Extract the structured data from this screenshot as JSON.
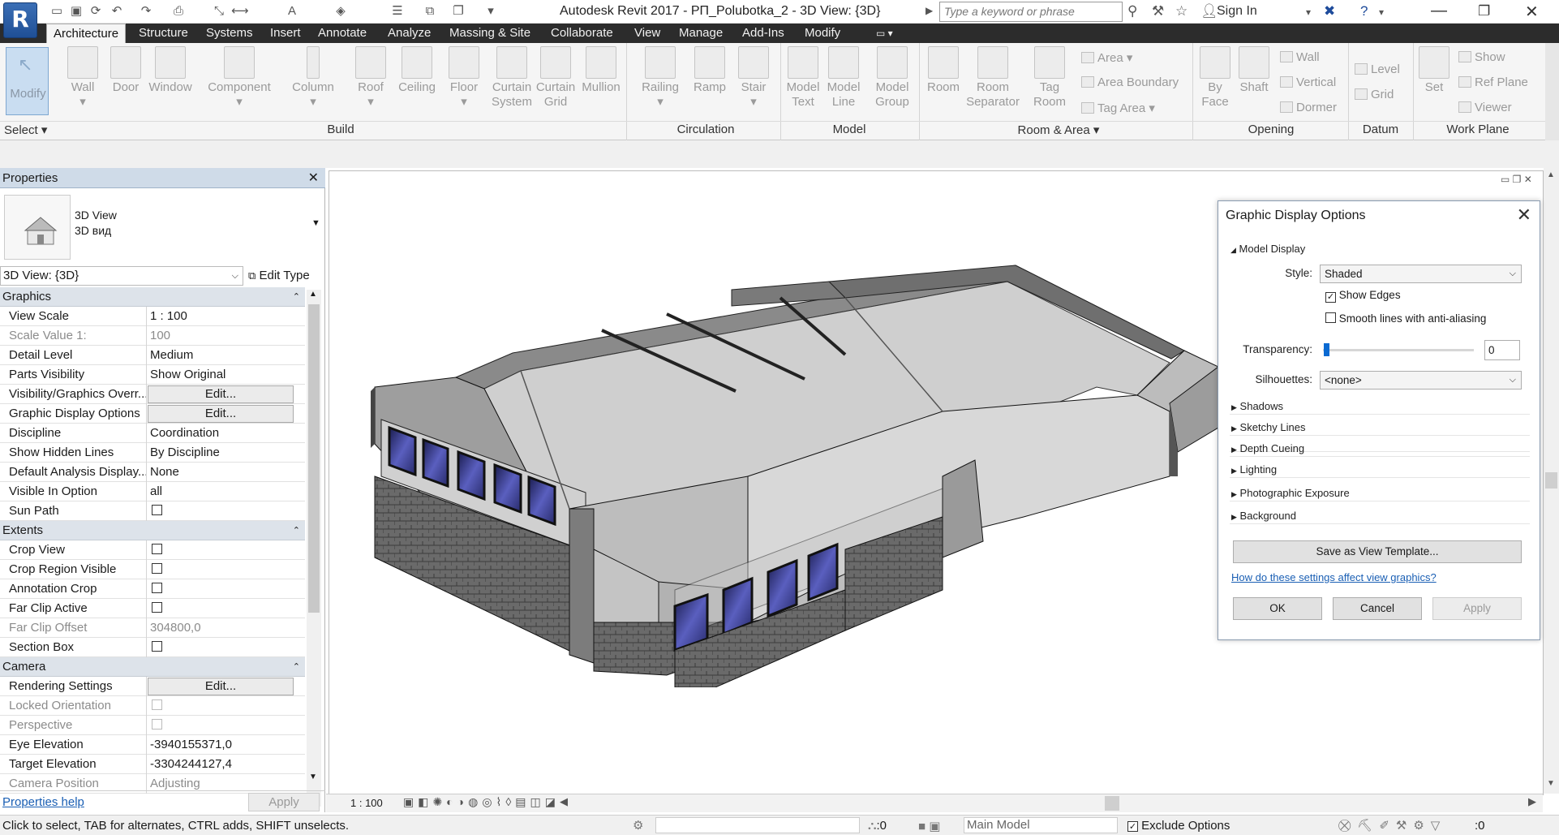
{
  "app": {
    "logo_letter": "R",
    "title": "Autodesk Revit 2017 -     РП_Polubotka_2 - 3D View: {3D}",
    "search_placeholder": "Type a keyword or phrase",
    "sign_in": "Sign In"
  },
  "tabs": [
    "Architecture",
    "Structure",
    "Systems",
    "Insert",
    "Annotate",
    "Analyze",
    "Massing & Site",
    "Collaborate",
    "View",
    "Manage",
    "Add-Ins",
    "Modify"
  ],
  "active_tab": "Architecture",
  "ribbon": {
    "modify": "Modify",
    "select": "Select",
    "build_buttons": [
      "Wall",
      "Door",
      "Window",
      "Component",
      "Column",
      "Roof",
      "Ceiling",
      "Floor",
      "Curtain System",
      "Curtain Grid",
      "Mullion"
    ],
    "circulation_buttons": [
      "Railing",
      "Ramp",
      "Stair"
    ],
    "model_buttons": [
      "Model Text",
      "Model Line",
      "Model Group"
    ],
    "room_buttons": [
      "Room",
      "Room Separator",
      "Tag Room"
    ],
    "room_small": [
      "Area",
      "Area  Boundary",
      "Tag  Area"
    ],
    "opening_buttons": [
      "By Face",
      "Shaft"
    ],
    "opening_small": [
      "Wall",
      "Vertical",
      "Dormer"
    ],
    "datum_small": [
      "Level",
      "Grid"
    ],
    "workplane_button": "Set",
    "workplane_small": [
      "Show",
      "Ref  Plane",
      "Viewer"
    ],
    "panels": [
      "Build",
      "Circulation",
      "Model",
      "Room & Area",
      "Opening",
      "Datum",
      "Work Plane"
    ]
  },
  "properties": {
    "header": "Properties",
    "type_name": "3D View",
    "type_sub": "3D вид",
    "instance": "3D View: {3D}",
    "edit_type": "Edit Type",
    "groups": [
      {
        "name": "Graphics",
        "rows": [
          {
            "k": "View Scale",
            "v": "1 : 100"
          },
          {
            "k": "Scale Value    1:",
            "v": "100",
            "disabled": true
          },
          {
            "k": "Detail Level",
            "v": "Medium"
          },
          {
            "k": "Parts Visibility",
            "v": "Show Original"
          },
          {
            "k": "Visibility/Graphics Overr...",
            "v": "Edit...",
            "button": true
          },
          {
            "k": "Graphic Display Options",
            "v": "Edit...",
            "button": true
          },
          {
            "k": "Discipline",
            "v": "Coordination"
          },
          {
            "k": "Show Hidden Lines",
            "v": "By Discipline"
          },
          {
            "k": "Default Analysis Display...",
            "v": "None"
          },
          {
            "k": "Visible In Option",
            "v": "all"
          },
          {
            "k": "Sun Path",
            "check": false
          }
        ]
      },
      {
        "name": "Extents",
        "rows": [
          {
            "k": "Crop View",
            "check": false
          },
          {
            "k": "Crop Region Visible",
            "check": false
          },
          {
            "k": "Annotation Crop",
            "check": false
          },
          {
            "k": "Far Clip Active",
            "check": false
          },
          {
            "k": "Far Clip Offset",
            "v": "304800,0",
            "disabled": true
          },
          {
            "k": "Section Box",
            "check": false
          }
        ]
      },
      {
        "name": "Camera",
        "rows": [
          {
            "k": "Rendering Settings",
            "v": "Edit...",
            "button": true
          },
          {
            "k": "Locked Orientation",
            "check": false,
            "disabled": true
          },
          {
            "k": "Perspective",
            "check": false,
            "disabled": true
          },
          {
            "k": "Eye Elevation",
            "v": "-3940155371,0"
          },
          {
            "k": "Target Elevation",
            "v": "-3304244127,4"
          },
          {
            "k": "Camera Position",
            "v": "Adjusting",
            "disabled": true
          }
        ]
      }
    ],
    "help": "Properties help",
    "apply": "Apply"
  },
  "dialog": {
    "title": "Graphic Display Options",
    "section_model": "Model Display",
    "style_label": "Style:",
    "style_value": "Shaded",
    "show_edges": "Show Edges",
    "show_edges_checked": true,
    "smooth": "Smooth lines with anti-aliasing",
    "smooth_checked": false,
    "transparency_label": "Transparency:",
    "transparency_value": "0",
    "silhouettes_label": "Silhouettes:",
    "silhouettes_value": "<none>",
    "sections": [
      "Shadows",
      "Sketchy Lines",
      "Depth Cueing",
      "Lighting",
      "Photographic Exposure",
      "Background"
    ],
    "save_template": "Save as View Template...",
    "help_link": "How do these settings affect view graphics?",
    "ok": "OK",
    "cancel": "Cancel",
    "apply": "Apply"
  },
  "viewbar": {
    "scale": "1 : 100"
  },
  "status": {
    "text": "Click to select, TAB for alternates, CTRL adds, SHIFT unselects.",
    "count_a": ":0",
    "main_model": "Main Model",
    "exclude_options": "Exclude Options",
    "filter_count": ":0"
  },
  "colors": {
    "accent": "#2c2c2c",
    "glass": "#3a3f9a",
    "props_header": "#cfdbe8"
  }
}
